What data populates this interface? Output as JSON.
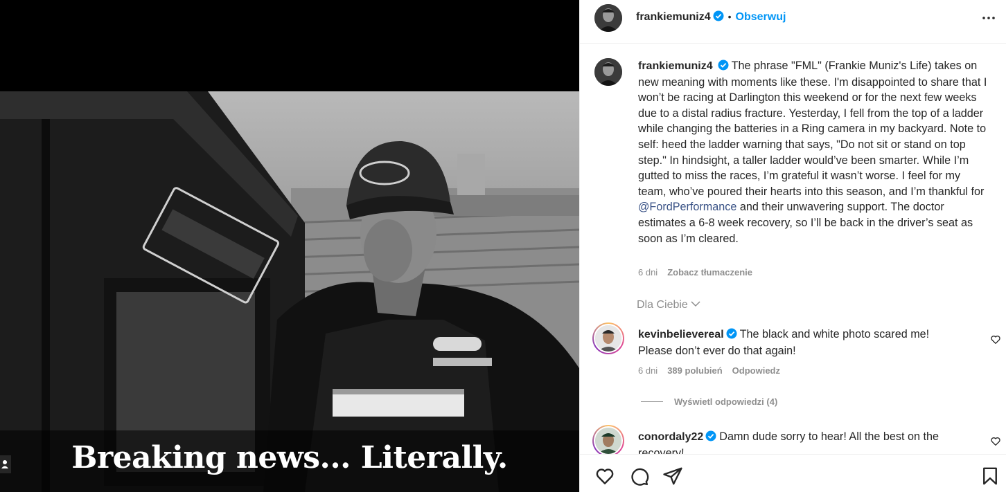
{
  "post": {
    "headline": "Breaking news... Literally."
  },
  "header": {
    "username": "frankiemuniz4",
    "separator": "•",
    "follow_label": "Obserwuj",
    "more_icon": "more-horizontal-icon"
  },
  "caption": {
    "username": "frankiemuniz4",
    "text_before": "The phrase \"FML\" (Frankie Muniz's Life) takes on new meaning with moments like these. I'm disappointed to share that I won’t be racing at Darlington this weekend or for the next few weeks due to a distal radius fracture. Yesterday, I fell from the top of a ladder while changing the batteries in a Ring camera in my backyard. Note to self: heed the ladder warning that says, \"Do not sit or stand on top step.\" In hindsight, a taller ladder would’ve been smarter. While I’m gutted to miss the races, I’m grateful it wasn’t worse. I feel for my team, who’ve poured their hearts into this season, and I’m thankful for ",
    "mention": "@FordPerformance",
    "text_after": " and their unwavering support. The doctor estimates a 6-8 week recovery, so I’ll be back in the driver’s seat as soon as I’m cleared.",
    "time": "6 dni",
    "translate_label": "Zobacz tłumaczenie"
  },
  "for_you": {
    "label": "Dla Ciebie"
  },
  "comments": [
    {
      "username": "kevinbelievereal",
      "text": "The black and white photo scared me! Please don’t ever do that again!",
      "time": "6 dni",
      "likes": "389 polubień",
      "reply_label": "Odpowiedz",
      "view_replies": "Wyświetl odpowiedzi (4)"
    },
    {
      "username": "conordaly22",
      "text": "Damn dude sorry to hear! All the best on the recovery!"
    }
  ],
  "colors": {
    "link": "#0095f6",
    "mention": "#385185",
    "verified": "#0095f6",
    "muted": "#8e8e8e"
  },
  "action_icons": [
    "heart-icon",
    "comment-icon",
    "share-icon",
    "bookmark-icon"
  ]
}
